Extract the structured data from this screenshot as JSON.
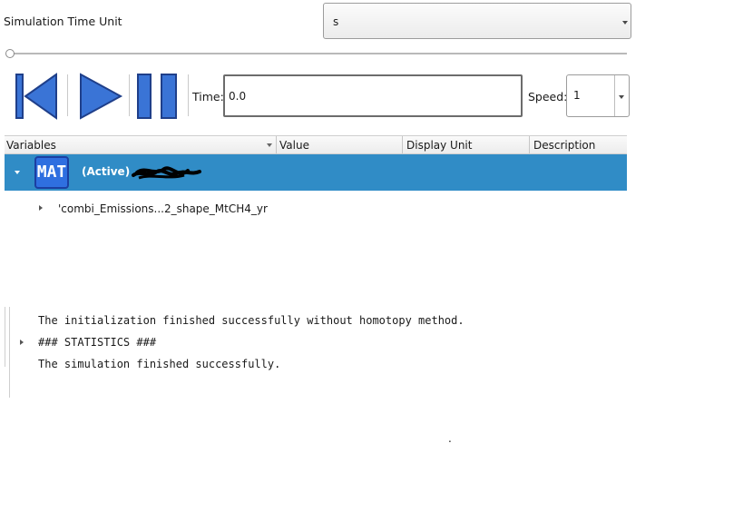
{
  "time_unit": {
    "label": "Simulation Time Unit",
    "value": "s"
  },
  "controls": {
    "time_label": "Time:",
    "time_value": "0.0",
    "speed_label": "Speed:",
    "speed_value": "1"
  },
  "tree": {
    "columns": [
      "Variables",
      "Value",
      "Display Unit",
      "Description"
    ],
    "active_row": {
      "icon_text": "MAT",
      "label": "(Active)"
    },
    "child_row": {
      "label": "'combi_Emissions...2_shape_MtCH4_yr"
    }
  },
  "messages": {
    "line1": "The initialization finished successfully without homotopy method.",
    "line2": "### STATISTICS ###",
    "line3": "The simulation finished successfully."
  },
  "misc": {
    "dot": "."
  },
  "colors": {
    "selection": "#308cc6",
    "icon_blue": "#2f6fe0",
    "control_blue": "#3a74d6"
  }
}
